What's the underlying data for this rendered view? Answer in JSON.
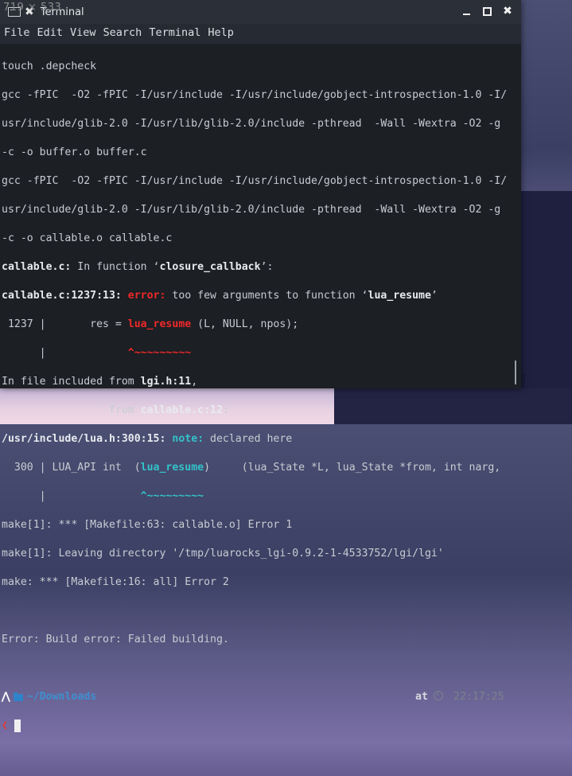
{
  "watermark": "719 × 533",
  "window": {
    "title": "Terminal",
    "menu": [
      "File",
      "Edit",
      "View",
      "Search",
      "Terminal",
      "Help"
    ]
  },
  "terminal": {
    "lines": {
      "l0": "touch .depcheck",
      "l1": "gcc -fPIC  -O2 -fPIC -I/usr/include -I/usr/include/gobject-introspection-1.0 -I/",
      "l2": "usr/include/glib-2.0 -I/usr/lib/glib-2.0/include -pthread  -Wall -Wextra -O2 -g",
      "l3": "-c -o buffer.o buffer.c",
      "l4": "gcc -fPIC  -O2 -fPIC -I/usr/include -I/usr/include/gobject-introspection-1.0 -I/",
      "l5": "usr/include/glib-2.0 -I/usr/lib/glib-2.0/include -pthread  -Wall -Wextra -O2 -g",
      "l6": "-c -o callable.o callable.c",
      "l7a": "callable.c:",
      "l7b": " In function ‘",
      "l7c": "closure_callback",
      "l7d": "’:",
      "l8a": "callable.c:1237:13: ",
      "l8b": "error: ",
      "l8c": "too few arguments to function ‘",
      "l8d": "lua_resume",
      "l8e": "’",
      "l9a": " 1237 |       res = ",
      "l9b": "lua_resume",
      "l9c": " (L, NULL, npos);",
      "l10a": "      |             ",
      "l10b": "^~~~~~~~~~",
      "l11a": "In file included from ",
      "l11b": "lgi.h:11",
      "l11c": ",",
      "l12a": "                 from ",
      "l12b": "callable.c:12",
      "l12c": ":",
      "l13a": "/usr/include/lua.h:300:15: ",
      "l13b": "note: ",
      "l13c": "declared here",
      "l14a": "  300 | LUA_API int  (",
      "l14b": "lua_resume",
      "l14c": ")     (lua_State *L, lua_State *from, int narg,",
      "l15a": "      |               ",
      "l15b": "^~~~~~~~~~",
      "l16": "make[1]: *** [Makefile:63: callable.o] Error 1",
      "l17": "make[1]: Leaving directory '/tmp/luarocks_lgi-0.9.2-1-4533752/lgi/lgi'",
      "l18": "make: *** [Makefile:16: all] Error 2",
      "l19": "",
      "l20": "Error: Build error: Failed building."
    },
    "prompt": {
      "arrow": "⋀",
      "path": "~/Downloads",
      "at": "at",
      "time": "22:17:25",
      "input_arrow": "❮"
    }
  },
  "colors": {
    "error": "#ef2929",
    "note": "#34c2c9",
    "path": "#3f8fd0",
    "background": "#1c1f24"
  }
}
